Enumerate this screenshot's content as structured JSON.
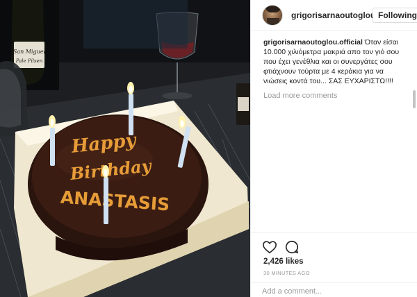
{
  "post": {
    "username": "grigorisarnaoutoglou",
    "follow_label": "Following",
    "caption_user": "grigorisarnaoutoglou.official",
    "caption_text": " Όταν είσαι 10.000 χιλιόμετρα μακριά απο τον γιό σου που έχει γενέθλια και οι συνεργάτες σου φτιάχνουν τούρτα με 4 κεράκια για να νιώσεις κοντά του... ΣΑΣ ΕΥΧΑΡΙΣΤΩ!!!!",
    "load_more": "Load more comments",
    "likes": "2,426 likes",
    "time_ago": "30 MINUTES AGO",
    "comment_placeholder": "Add a comment...",
    "icons": [
      "heart-icon",
      "comment-icon"
    ]
  },
  "photo": {
    "cake_text": [
      "Happy",
      "Birthday",
      "ANASTASIS"
    ],
    "bottle_labels": [
      "San Miguel",
      "Pale Pilsen"
    ],
    "frosting_color": "#f0a33a"
  }
}
